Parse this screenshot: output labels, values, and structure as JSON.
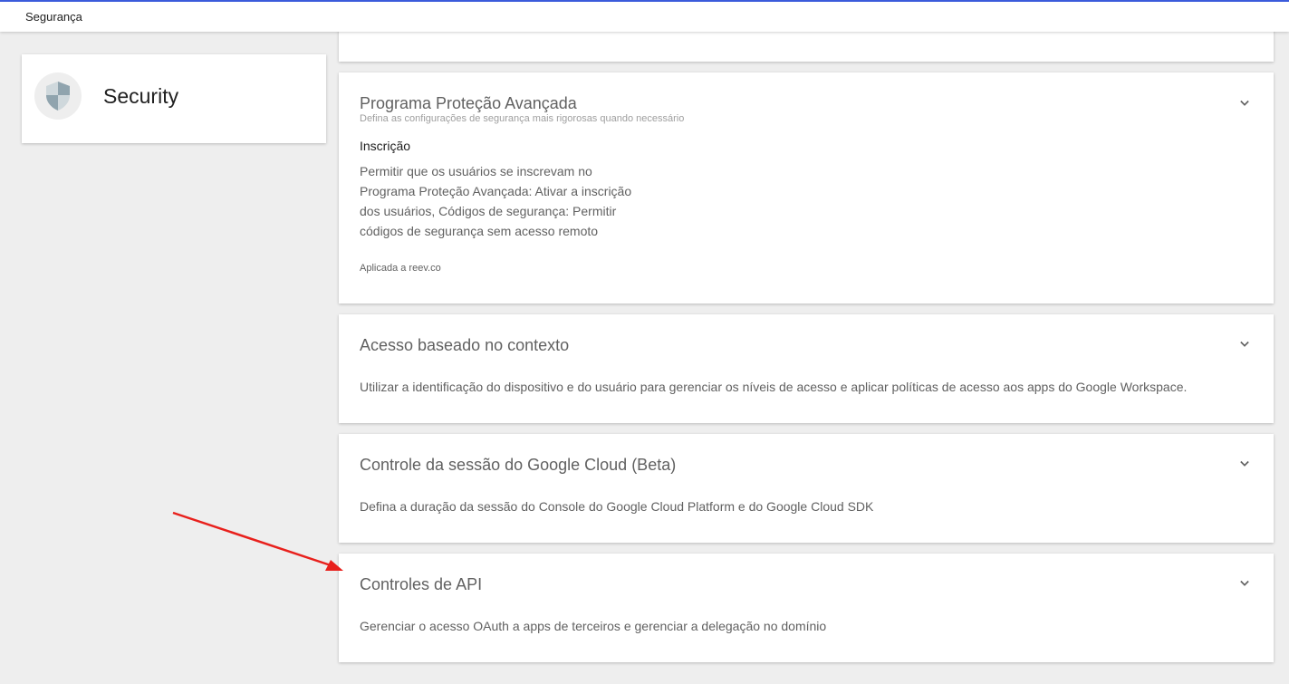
{
  "topbar": {
    "title": "Segurança"
  },
  "security_card": {
    "label": "Security",
    "icon": "shield-icon"
  },
  "panels": [
    {
      "title": "Programa Proteção Avançada",
      "subtitle": "Defina as configurações de segurança mais rigorosas quando necessário",
      "section_label": "Inscrição",
      "lines": [
        "Permitir que os usuários se inscrevam no",
        "Programa Proteção Avançada: Ativar a inscrição",
        "dos usuários, Códigos de segurança: Permitir",
        "códigos de segurança sem acesso remoto"
      ],
      "applied": "Aplicada a reev.co"
    },
    {
      "title": "Acesso baseado no contexto",
      "description": "Utilizar a identificação do dispositivo e do usuário para gerenciar os níveis de acesso e aplicar políticas de acesso aos apps do Google Workspace."
    },
    {
      "title": "Controle da sessão do Google Cloud (Beta)",
      "description": "Defina a duração da sessão do Console do Google Cloud Platform e do Google Cloud SDK"
    },
    {
      "title": "Controles de API",
      "description": "Gerenciar o acesso OAuth a apps de terceiros e gerenciar a delegação no domínio"
    }
  ],
  "colors": {
    "accent_top": "#3b5bdb",
    "annotation_arrow": "#e8201c",
    "background": "#eeeeee"
  }
}
